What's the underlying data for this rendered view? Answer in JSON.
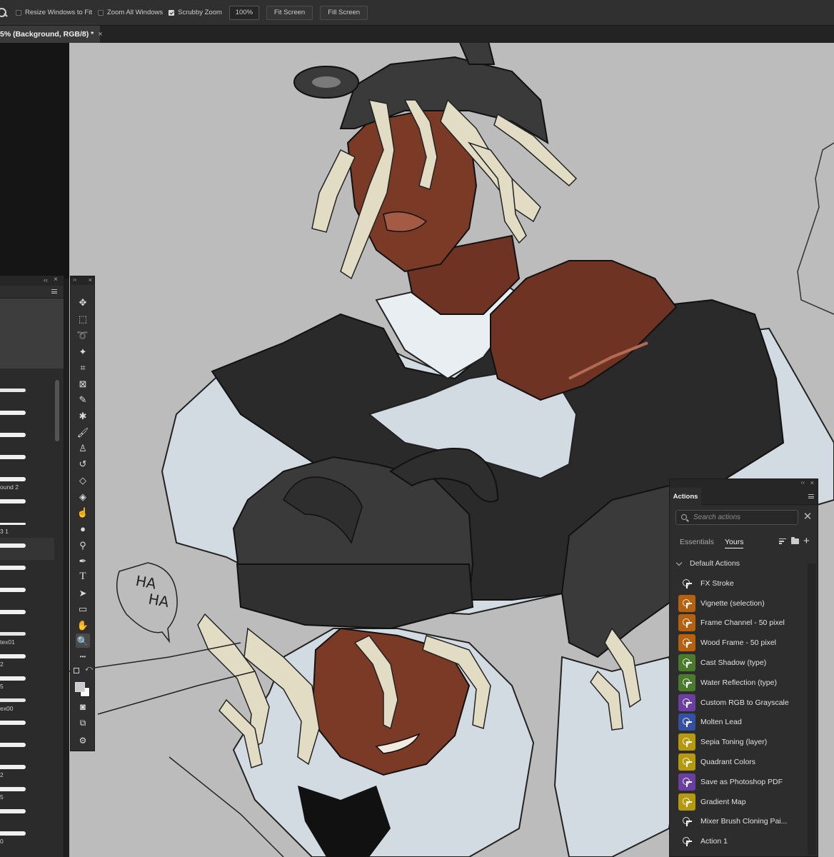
{
  "options_bar": {
    "tool_icon": "zoom-icon",
    "resize_windows": {
      "label": "Resize Windows to Fit",
      "checked": false
    },
    "zoom_all": {
      "label": "Zoom All Windows",
      "checked": false
    },
    "scrubby_zoom": {
      "label": "Scrubby Zoom",
      "checked": true
    },
    "zoom_value": "100%",
    "fit_screen": "Fit Screen",
    "fill_screen": "Fill Screen"
  },
  "document_tab": {
    "title": "5% (Background, RGB/8) *",
    "close": "×"
  },
  "brushes_panel": {
    "collapse": "‹‹",
    "close": "×",
    "items": [
      {
        "label": ""
      },
      {
        "label": ""
      },
      {
        "label": ""
      },
      {
        "label": ""
      },
      {
        "label": "ound 2"
      },
      {
        "label": ""
      },
      {
        "label": "3 1"
      },
      {
        "label": ""
      },
      {
        "label": ""
      },
      {
        "label": ""
      },
      {
        "label": ""
      },
      {
        "label": "tex01"
      },
      {
        "label": "2"
      },
      {
        "label": "5"
      },
      {
        "label": "ex00"
      },
      {
        "label": ""
      },
      {
        "label": ""
      },
      {
        "label": "2"
      },
      {
        "label": "5"
      },
      {
        "label": ""
      },
      {
        "label": "0"
      }
    ]
  },
  "toolbar": {
    "expand": "››",
    "close": "×",
    "tools": [
      {
        "name": "move-tool-icon",
        "glyph": "✥"
      },
      {
        "name": "marquee-tool-icon",
        "glyph": "⬚"
      },
      {
        "name": "lasso-tool-icon",
        "glyph": "➰"
      },
      {
        "name": "magic-wand-tool-icon",
        "glyph": "✦"
      },
      {
        "name": "crop-tool-icon",
        "glyph": "⌗"
      },
      {
        "name": "frame-tool-icon",
        "glyph": "⊠"
      },
      {
        "name": "eyedropper-tool-icon",
        "glyph": "✎"
      },
      {
        "name": "healing-brush-tool-icon",
        "glyph": "✱"
      },
      {
        "name": "brush-tool-icon",
        "glyph": "🖌"
      },
      {
        "name": "clone-stamp-tool-icon",
        "glyph": "♙"
      },
      {
        "name": "history-brush-tool-icon",
        "glyph": "↺"
      },
      {
        "name": "eraser-tool-icon",
        "glyph": "◇"
      },
      {
        "name": "paint-bucket-tool-icon",
        "glyph": "◈"
      },
      {
        "name": "smudge-tool-icon",
        "glyph": "☝"
      },
      {
        "name": "dodge-tool-icon",
        "glyph": "●"
      },
      {
        "name": "burn-tool-icon",
        "glyph": "⚲"
      },
      {
        "name": "pen-tool-icon",
        "glyph": "✒"
      },
      {
        "name": "type-tool-icon",
        "glyph": "T"
      },
      {
        "name": "path-selection-tool-icon",
        "glyph": "➤"
      },
      {
        "name": "rectangle-tool-icon",
        "glyph": "▭"
      },
      {
        "name": "hand-tool-icon",
        "glyph": "✋"
      },
      {
        "name": "zoom-tool-icon",
        "glyph": "🔍"
      },
      {
        "name": "more-tools-icon",
        "glyph": "•••"
      }
    ],
    "quick_mask": "◙",
    "screen_mode": "⧉",
    "generative": "⚙"
  },
  "canvas": {
    "speech_text_line1": "HA",
    "speech_text_line2": "HA"
  },
  "actions_panel": {
    "tab_label": "Actions",
    "collapse": "‹‹",
    "close": "×",
    "search_placeholder": "Search actions",
    "clear": "✕",
    "tab_essentials": "Essentials",
    "tab_yours": "Yours",
    "plus": "+",
    "set_name": "Default Actions",
    "items": [
      {
        "label": "FX Stroke",
        "color": "none"
      },
      {
        "label": "Vignette (selection)",
        "color": "#b5610f"
      },
      {
        "label": "Frame Channel - 50 pixel",
        "color": "#b5610f"
      },
      {
        "label": "Wood Frame - 50 pixel",
        "color": "#b5610f"
      },
      {
        "label": "Cast Shadow (type)",
        "color": "#4a7a2c"
      },
      {
        "label": "Water Reflection (type)",
        "color": "#4a7a2c"
      },
      {
        "label": "Custom RGB to Grayscale",
        "color": "#6a3fa0"
      },
      {
        "label": "Molten Lead",
        "color": "#3550a0"
      },
      {
        "label": "Sepia Toning (layer)",
        "color": "#b59a0f"
      },
      {
        "label": "Quadrant Colors",
        "color": "#b59a0f"
      },
      {
        "label": "Save as Photoshop PDF",
        "color": "#6a3fa0"
      },
      {
        "label": "Gradient Map",
        "color": "#b59a0f"
      },
      {
        "label": "Mixer Brush Cloning Pai...",
        "color": "none"
      },
      {
        "label": "Action 1",
        "color": "none"
      }
    ]
  }
}
